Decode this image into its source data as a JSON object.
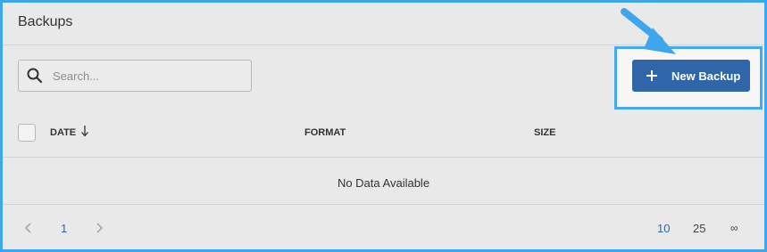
{
  "header": {
    "title": "Backups"
  },
  "search": {
    "placeholder": "Search...",
    "value": ""
  },
  "toolbar": {
    "new_backup_label": "New Backup"
  },
  "table": {
    "columns": [
      "DATE",
      "FORMAT",
      "SIZE"
    ],
    "sort": {
      "column": "DATE",
      "direction": "descending"
    },
    "rows": [],
    "empty_message": "No Data Available"
  },
  "pagination": {
    "current_page": "1",
    "per_page_options": [
      "10",
      "25",
      "∞"
    ],
    "selected_per_page": "10"
  },
  "icons": {
    "search": "search-icon",
    "plus": "plus-icon",
    "sort": "arrow-down-icon",
    "prev": "chevron-left-icon",
    "next": "chevron-right-icon"
  },
  "colors": {
    "accent": "#2f66aa",
    "highlight": "#3fa6ee",
    "background": "#e9e9e9"
  }
}
